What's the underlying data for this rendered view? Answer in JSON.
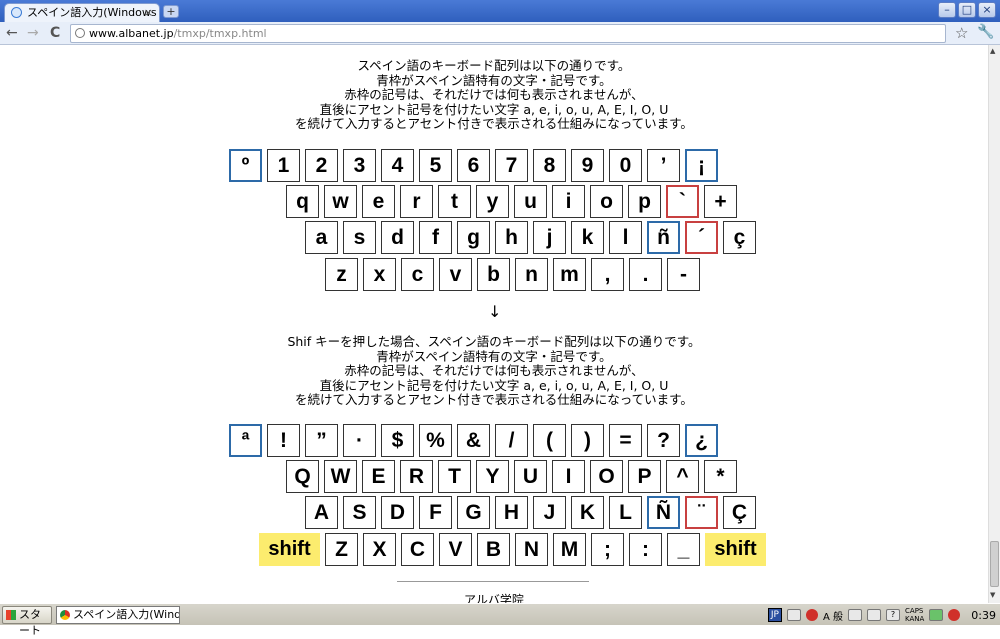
{
  "browser": {
    "tab_title": "スペイン語入力(Windows XP",
    "tab_close": "×",
    "newtab": "+",
    "win_min": "–",
    "win_max": "□",
    "win_close": "×",
    "back": "←",
    "forward": "→",
    "reload": "C",
    "url_host": "www.albanet.jp",
    "url_path": "/tmxp/tmxp.html",
    "star": "☆",
    "wrench": "🔧"
  },
  "intro1": {
    "lines": [
      "スペイン語のキーボード配列は以下の通りです。",
      "青枠がスペイン語特有の文字・記号です。",
      "赤枠の記号は、それだけでは何も表示されませんが、",
      "直後にアセント記号を付けたい文字 a, e, i, o, u, A, E, I, O, U",
      "を続けて入力するとアセント付きで表示される仕組みになっています。"
    ]
  },
  "intro2": {
    "lines": [
      "Shif キーを押した場合、スペイン語のキーボード配列は以下の通りです。",
      "青枠がスペイン語特有の文字・記号です。",
      "赤枠の記号は、それだけでは何も表示されませんが、",
      "直後にアセント記号を付けたい文字 a, e, i, o, u, A, E, I, O, U",
      "を続けて入力するとアセント付きで表示される仕組みになっています。"
    ]
  },
  "arrow": "↓",
  "keyboard1": {
    "row1": [
      "º",
      "1",
      "2",
      "3",
      "4",
      "5",
      "6",
      "7",
      "8",
      "9",
      "0",
      "’",
      "¡"
    ],
    "row2": [
      "q",
      "w",
      "e",
      "r",
      "t",
      "y",
      "u",
      "i",
      "o",
      "p",
      "`",
      "+"
    ],
    "row3": [
      "a",
      "s",
      "d",
      "f",
      "g",
      "h",
      "j",
      "k",
      "l",
      "ñ",
      "´",
      "ç"
    ],
    "row4": [
      "z",
      "x",
      "c",
      "v",
      "b",
      "n",
      "m",
      ",",
      ".",
      "-"
    ]
  },
  "keyboard2": {
    "row1": [
      "ª",
      "!",
      "”",
      "·",
      "$",
      "%",
      "&",
      "/",
      "(",
      ")",
      "=",
      "?",
      "¿"
    ],
    "row2": [
      "Q",
      "W",
      "E",
      "R",
      "T",
      "Y",
      "U",
      "I",
      "O",
      "P",
      "^",
      "*"
    ],
    "row3": [
      "A",
      "S",
      "D",
      "F",
      "G",
      "H",
      "J",
      "K",
      "L",
      "Ñ",
      "¨",
      "Ç"
    ],
    "row4": [
      "shift",
      "Z",
      "X",
      "C",
      "V",
      "B",
      "N",
      "M",
      ";",
      ":",
      "_",
      "shift"
    ]
  },
  "footer": "アルバ学院",
  "taskbar": {
    "start": "スタート",
    "task": "スペイン語入力(Windo...",
    "ime": "JP",
    "ime_mode": "A 般",
    "caps": "CAPS",
    "kana": "KANA",
    "clock": "0:39"
  }
}
